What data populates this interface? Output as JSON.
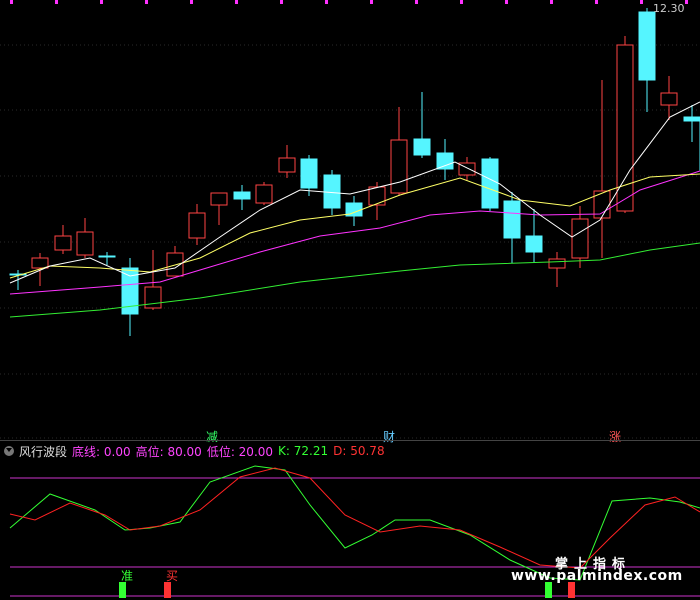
{
  "main_chart": {
    "price_high_label": "12.30",
    "event_labels": [
      {
        "text": "减",
        "color": "#33ff66"
      },
      {
        "text": "财",
        "color": "#66ccff"
      },
      {
        "text": "涨",
        "color": "#ff5555"
      }
    ]
  },
  "indicator": {
    "name": "风行波段",
    "params": [
      {
        "label": "底线: 0.00",
        "color": "#ff44ff"
      },
      {
        "label": "高位: 80.00",
        "color": "#ff44ff"
      },
      {
        "label": "低位: 20.00",
        "color": "#ff44ff"
      },
      {
        "label": "K: 72.21",
        "color": "#33ff33"
      },
      {
        "label": "D: 50.78",
        "color": "#ff3333"
      }
    ],
    "signal_labels": [
      {
        "text": "准",
        "color": "#33ff33"
      },
      {
        "text": "买",
        "color": "#ff3333"
      }
    ]
  },
  "watermark": {
    "cn": "掌上指标",
    "url": "www.palmindex.com"
  },
  "colors": {
    "up": "#ff4444",
    "down": "#55f5ff",
    "ma5": "#ffffff",
    "ma10": "#ffff66",
    "ma20": "#ff33ff",
    "ma60": "#33ee33",
    "k_line": "#33ff33",
    "d_line": "#ff2222",
    "level_line": "#cc33cc"
  }
}
